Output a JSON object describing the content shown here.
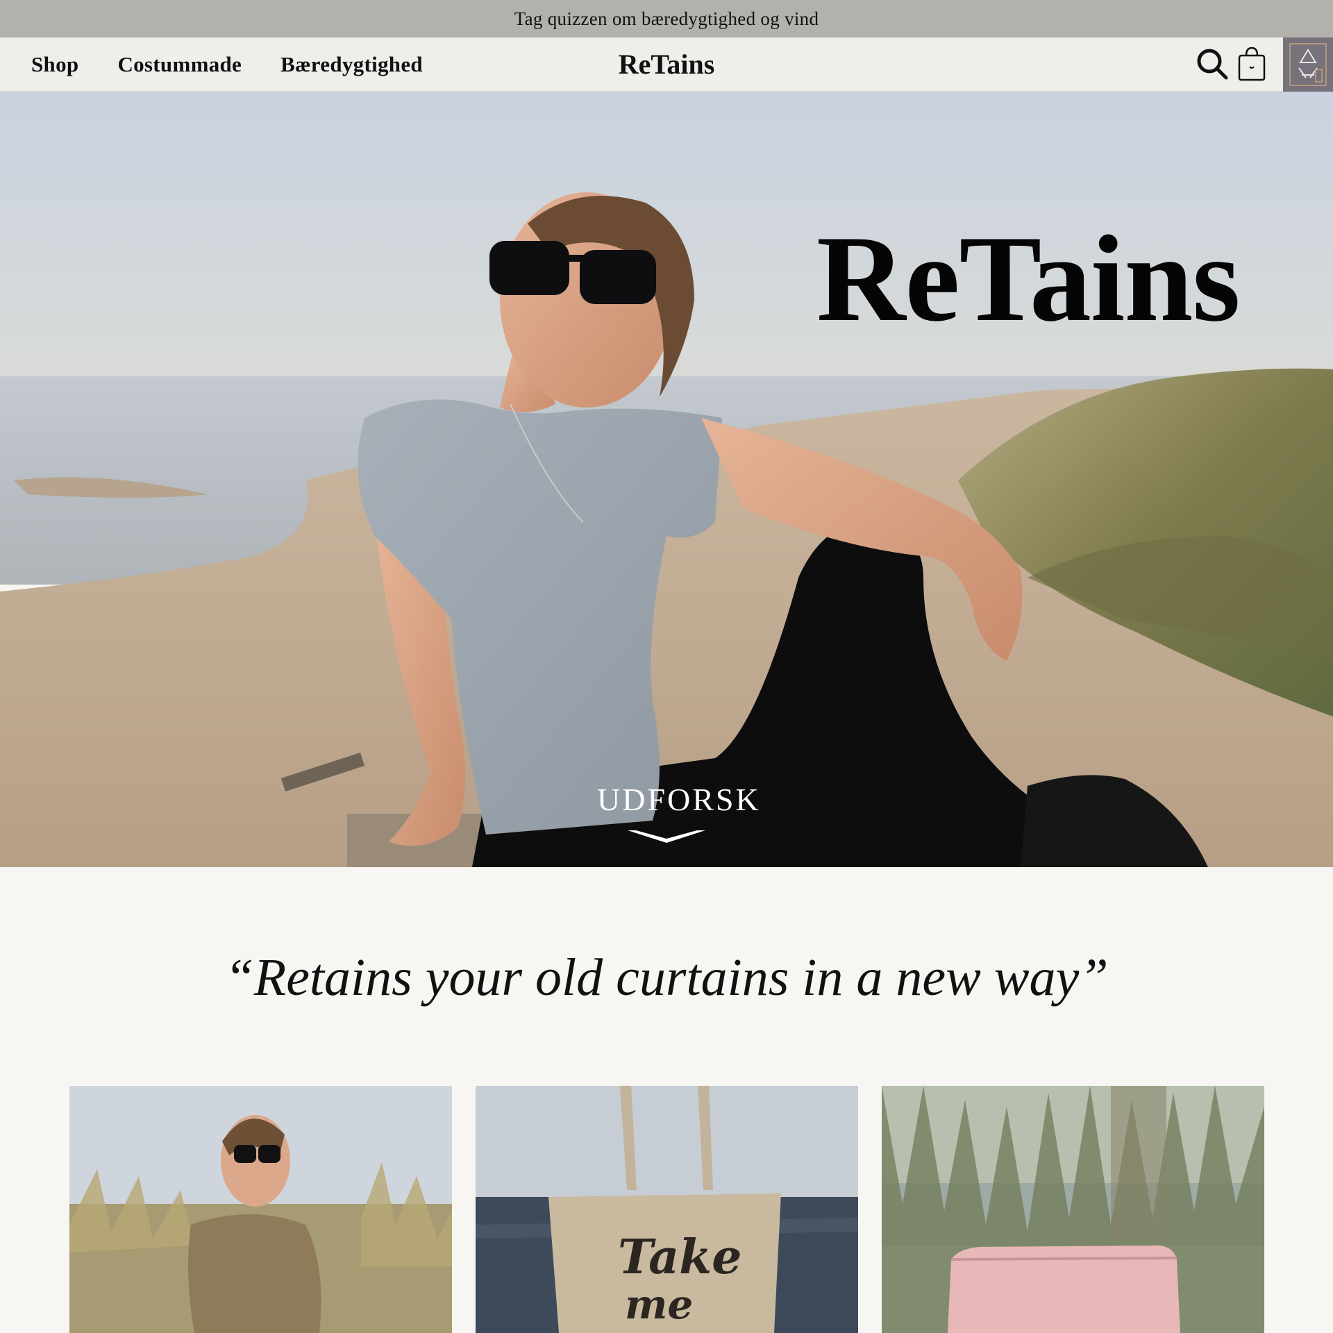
{
  "announcement": {
    "text": "Tag quizzen om bæredygtighed og vind"
  },
  "header": {
    "nav": [
      {
        "label": "Shop"
      },
      {
        "label": "Costummade"
      },
      {
        "label": "Bæredygtighed"
      }
    ],
    "brand": "ReTains",
    "icons": [
      "search-icon",
      "cart-icon",
      "recycle-badge-icon"
    ]
  },
  "hero": {
    "title": "ReTains",
    "cta": "UDFORSK"
  },
  "quote": {
    "text": "“Retains your old curtains in a new way”"
  },
  "tote_print": "Take me",
  "colors": {
    "announcement_bg": "#b3b1ab",
    "header_bg": "#efeeeb",
    "page_bg": "#f7f6f2",
    "badge_bg": "#76717a",
    "text": "#111111"
  }
}
